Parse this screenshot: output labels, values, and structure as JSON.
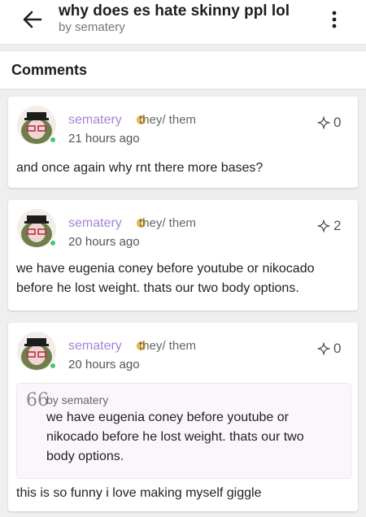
{
  "topbar": {
    "title": "why does es hate skinny ppl lol",
    "subtitle": "by sematery"
  },
  "comments_header": {
    "label": "Comments"
  },
  "colors": {
    "username": "#a583d6",
    "online": "#4cc46a",
    "badge": "#f0b52a"
  },
  "comments": [
    {
      "username": "sematery",
      "pronouns": "they/ them",
      "time": "21 hours ago",
      "likes": "0",
      "text": "and once again why rnt there more bases?"
    },
    {
      "username": "sematery",
      "pronouns": "they/ them",
      "time": "20 hours ago",
      "likes": "2",
      "text": "we have eugenia coney before youtube or nikocado before he lost weight. thats our two body options."
    },
    {
      "username": "sematery",
      "pronouns": "they/ them",
      "time": "20 hours ago",
      "likes": "0",
      "quote": {
        "icon": "66",
        "by": "by sematery",
        "text": "we have eugenia coney before youtube or nikocado before he lost weight. thats our two body options."
      },
      "text": "this is so funny i love making myself giggle"
    }
  ]
}
